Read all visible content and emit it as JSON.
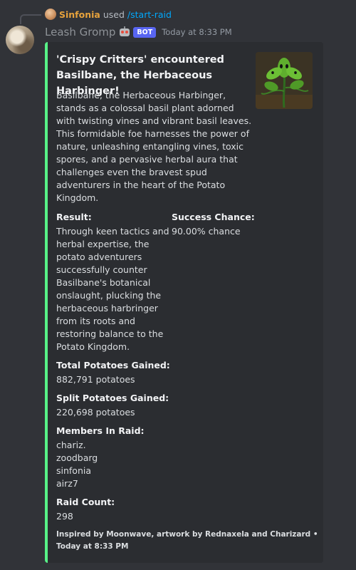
{
  "reply": {
    "user": "Sinfonia",
    "used": "used",
    "command": "/start-raid"
  },
  "author": {
    "name": "Leash Gromp",
    "badge": "BOT",
    "timestamp": "Today at 8:33 PM"
  },
  "embed": {
    "accent_color": "#57f287",
    "title": "'Crispy Critters' encountered Basilbane, the Herbaceous Harbinger!",
    "description": "Basilbane, the Herbaceous Harbinger, stands as a colossal basil plant adorned with twisting vines and vibrant basil leaves. This formidable foe harnesses the power of nature, unleashing entangling vines, toxic spores, and a pervasive herbal aura that challenges even the bravest spud adventurers in the heart of the Potato Kingdom.",
    "fields": {
      "result_name": "Result:",
      "result_value": "Through keen tactics and herbal expertise, the potato adventurers successfully counter Basilbane's botanical onslaught, plucking the herbaceous harbringer from its roots and restoring balance to the Potato Kingdom.",
      "success_name": "Success Chance:",
      "success_value": "90.00% chance",
      "total_name": "Total Potatoes Gained:",
      "total_value": "882,791 potatoes",
      "split_name": "Split Potatoes Gained:",
      "split_value": "220,698 potatoes",
      "members_name": "Members In Raid:",
      "members": [
        "chariz.",
        "zoodbarg",
        "sinfonia",
        "airz7"
      ],
      "raid_count_name": "Raid Count:",
      "raid_count_value": "298"
    },
    "footer": "Inspired by Moonwave, artwork by Rednaxela and Charizard • Today at 8:33 PM"
  }
}
